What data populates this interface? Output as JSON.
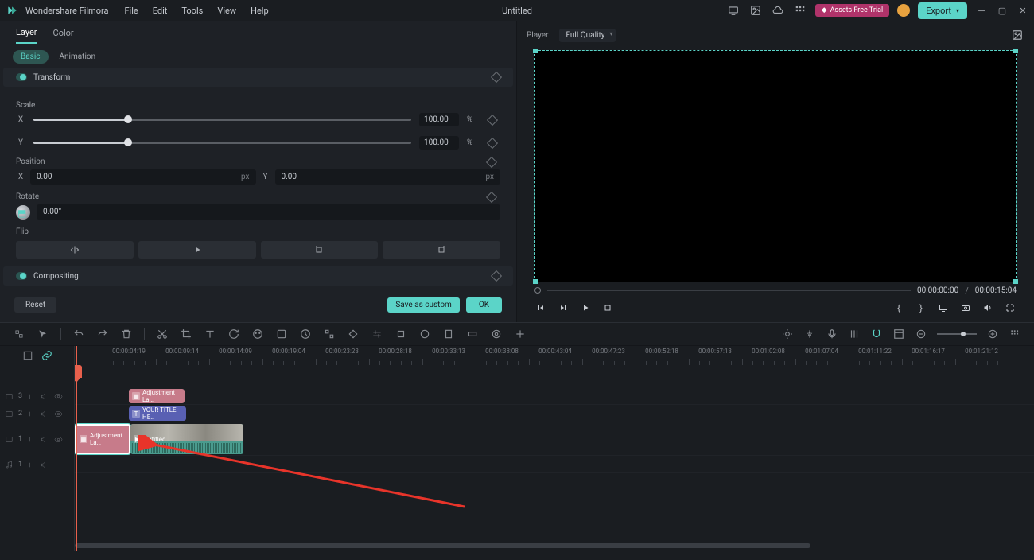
{
  "app": {
    "name": "Wondershare Filmora",
    "title": "Untitled"
  },
  "menu": [
    "File",
    "Edit",
    "Tools",
    "View",
    "Help"
  ],
  "topright": {
    "assets_label": "Assets Free Trial",
    "export_label": "Export"
  },
  "inspector": {
    "tabs": [
      "Layer",
      "Color"
    ],
    "active_tab": "Layer",
    "subtabs": {
      "active": "Basic",
      "other": "Animation"
    },
    "sections": {
      "transform": "Transform",
      "compositing": "Compositing"
    },
    "scale": {
      "label": "Scale",
      "x": "100.00",
      "y": "100.00",
      "unit": "%"
    },
    "position": {
      "label": "Position",
      "x": "0.00",
      "y": "0.00",
      "unit": "px"
    },
    "rotate": {
      "label": "Rotate",
      "value": "0.00°"
    },
    "flip": {
      "label": "Flip"
    },
    "buttons": {
      "reset": "Reset",
      "save_custom": "Save as custom",
      "ok": "OK"
    }
  },
  "player": {
    "label": "Player",
    "quality": "Full Quality",
    "time_current": "00:00:00:00",
    "time_total": "00:00:15:04"
  },
  "timeline": {
    "ruler_labels": [
      "00:00:04:19",
      "00:00:09:14",
      "00:00:14:09",
      "00:00:19:04",
      "00:00:23:23",
      "00:00:28:18",
      "00:00:33:13",
      "00:00:38:08",
      "00:00:43:04",
      "00:00:47:23",
      "00:00:52:18",
      "00:00:57:13",
      "00:01:02:08",
      "00:01:07:04",
      "00:01:11:22",
      "00:01:16:17",
      "00:01:21:12"
    ],
    "tracks": {
      "v3": {
        "icon": "video",
        "num": "3"
      },
      "v2": {
        "icon": "video",
        "num": "2"
      },
      "v1": {
        "icon": "video",
        "num": "1"
      },
      "a1": {
        "icon": "audio",
        "num": "1"
      }
    },
    "clips": {
      "adj3": "Adjustment La…",
      "title": "YOUR TITLE HE…",
      "adj1": "Adjustment La…",
      "video": "Untitled"
    }
  }
}
